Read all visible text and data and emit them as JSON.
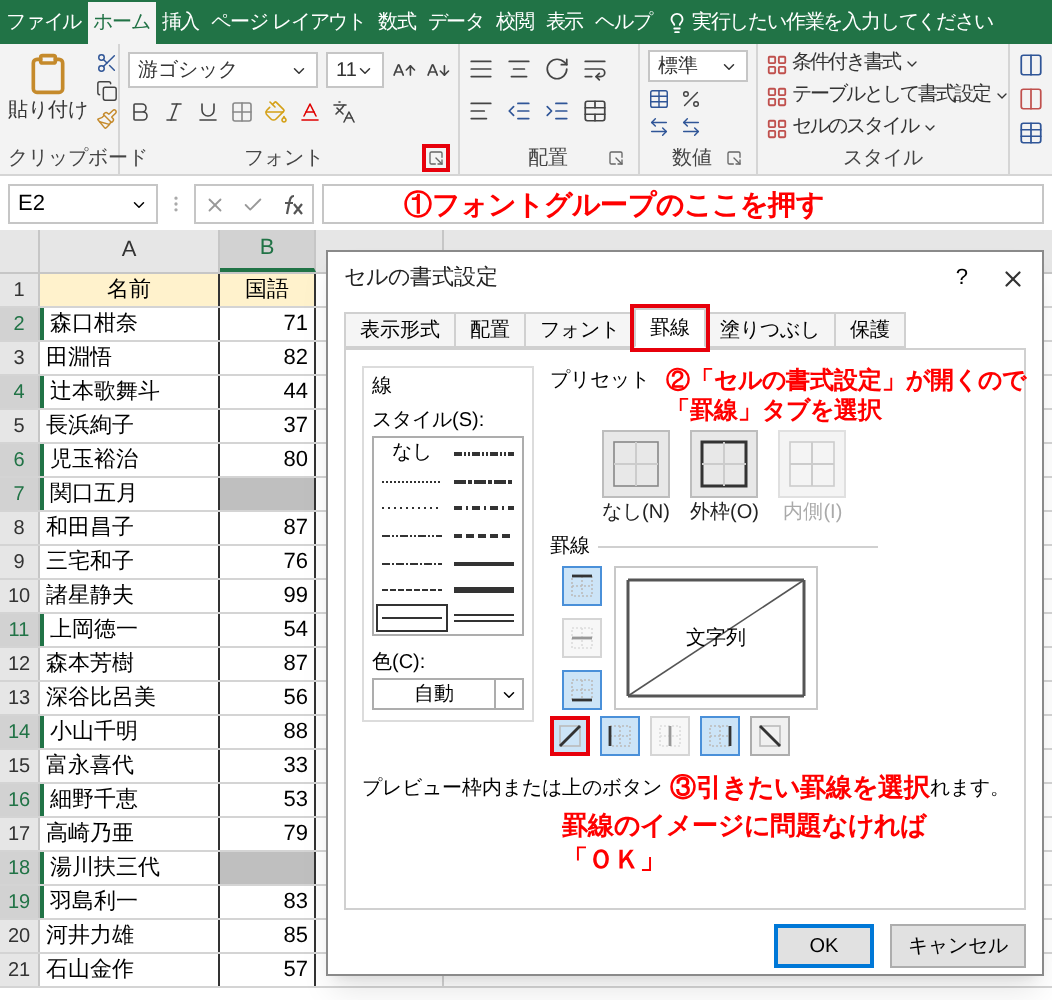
{
  "ribbon_tabs": [
    {
      "label": "ファイル",
      "selected": false
    },
    {
      "label": "ホーム",
      "selected": true
    },
    {
      "label": "挿入",
      "selected": false
    },
    {
      "label": "ページ レイアウト",
      "selected": false
    },
    {
      "label": "数式",
      "selected": false
    },
    {
      "label": "データ",
      "selected": false
    },
    {
      "label": "校閲",
      "selected": false
    },
    {
      "label": "表示",
      "selected": false
    },
    {
      "label": "ヘルプ",
      "selected": false
    }
  ],
  "tell_me": {
    "placeholder": "実行したい作業を入力してください"
  },
  "ribbon": {
    "clipboard": {
      "paste_label": "貼り付け",
      "group_label": "クリップボード"
    },
    "font": {
      "font_name": "游ゴシック",
      "font_size": "11",
      "group_label": "フォント",
      "launcher_highlighted": true
    },
    "alignment": {
      "group_label": "配置"
    },
    "number": {
      "format": "標準",
      "group_label": "数値"
    },
    "styles": {
      "items": [
        "条件付き書式",
        "テーブルとして書式設定",
        "セルのスタイル"
      ],
      "group_label": "スタイル"
    }
  },
  "formula_bar": {
    "name_box": "E2"
  },
  "annotations": {
    "step1": "①フォントグループのここを押す",
    "step2": [
      "②「セルの書式設定」が開くので",
      "「罫線」タブを選択"
    ],
    "step3": [
      "③引きたい罫線を選択",
      "罫線のイメージに問題なければ",
      "「ＯＫ」"
    ]
  },
  "sheet": {
    "columns": [
      {
        "label": "A",
        "selected": false
      },
      {
        "label": "B",
        "selected": true
      }
    ],
    "rows": [
      {
        "number": "1",
        "selected": false,
        "kind": "header",
        "cells": [
          {
            "text": "名前"
          },
          {
            "text": "国語"
          }
        ]
      },
      {
        "number": "2",
        "selected": true,
        "kind": "data",
        "cells": [
          {
            "text": "森口柑奈"
          },
          {
            "text": "71"
          }
        ]
      },
      {
        "number": "3",
        "selected": false,
        "kind": "data",
        "cells": [
          {
            "text": "田淵悟"
          },
          {
            "text": "82"
          }
        ]
      },
      {
        "number": "4",
        "selected": true,
        "kind": "data",
        "cells": [
          {
            "text": "辻本歌舞斗"
          },
          {
            "text": "44"
          }
        ]
      },
      {
        "number": "5",
        "selected": false,
        "kind": "data",
        "cells": [
          {
            "text": "長浜絢子"
          },
          {
            "text": "37"
          }
        ]
      },
      {
        "number": "6",
        "selected": true,
        "kind": "data",
        "cells": [
          {
            "text": "児玉裕治"
          },
          {
            "text": "80"
          }
        ]
      },
      {
        "number": "7",
        "selected": true,
        "kind": "data",
        "cells": [
          {
            "text": "関口五月"
          },
          {
            "shaded": true
          }
        ]
      },
      {
        "number": "8",
        "selected": false,
        "kind": "data",
        "cells": [
          {
            "text": "和田昌子"
          },
          {
            "text": "87"
          }
        ]
      },
      {
        "number": "9",
        "selected": false,
        "kind": "data",
        "cells": [
          {
            "text": "三宅和子"
          },
          {
            "text": "76"
          }
        ]
      },
      {
        "number": "10",
        "selected": false,
        "kind": "data",
        "cells": [
          {
            "text": "諸星静夫"
          },
          {
            "text": "99"
          }
        ]
      },
      {
        "number": "11",
        "selected": true,
        "kind": "data",
        "cells": [
          {
            "text": "上岡徳一"
          },
          {
            "text": "54"
          }
        ]
      },
      {
        "number": "12",
        "selected": false,
        "kind": "data",
        "cells": [
          {
            "text": "森本芳樹"
          },
          {
            "text": "87"
          }
        ]
      },
      {
        "number": "13",
        "selected": false,
        "kind": "data",
        "cells": [
          {
            "text": "深谷比呂美"
          },
          {
            "text": "56"
          }
        ]
      },
      {
        "number": "14",
        "selected": true,
        "kind": "data",
        "cells": [
          {
            "text": "小山千明"
          },
          {
            "text": "88"
          }
        ]
      },
      {
        "number": "15",
        "selected": false,
        "kind": "data",
        "cells": [
          {
            "text": "富永喜代"
          },
          {
            "text": "33"
          }
        ]
      },
      {
        "number": "16",
        "selected": true,
        "kind": "data",
        "cells": [
          {
            "text": "細野千恵"
          },
          {
            "text": "53"
          }
        ]
      },
      {
        "number": "17",
        "selected": false,
        "kind": "data",
        "cells": [
          {
            "text": "高崎乃亜"
          },
          {
            "text": "79"
          }
        ]
      },
      {
        "number": "18",
        "selected": true,
        "kind": "data",
        "cells": [
          {
            "text": "湯川扶三代"
          },
          {
            "shaded": true
          }
        ]
      },
      {
        "number": "19",
        "selected": true,
        "kind": "data",
        "cells": [
          {
            "text": "羽島利一"
          },
          {
            "text": "83"
          }
        ]
      },
      {
        "number": "20",
        "selected": false,
        "kind": "data",
        "cells": [
          {
            "text": "河井力雄"
          },
          {
            "text": "85"
          }
        ]
      },
      {
        "number": "21",
        "selected": false,
        "kind": "data",
        "cells": [
          {
            "text": "石山金作"
          },
          {
            "text": "57"
          }
        ]
      }
    ]
  },
  "dialog": {
    "title": "セルの書式設定",
    "help": "?",
    "tabs": [
      {
        "label": "表示形式",
        "selected": false,
        "highlighted": false
      },
      {
        "label": "配置",
        "selected": false,
        "highlighted": false
      },
      {
        "label": "フォント",
        "selected": false,
        "highlighted": false
      },
      {
        "label": "罫線",
        "selected": true,
        "highlighted": true
      },
      {
        "label": "塗りつぶし",
        "selected": false,
        "highlighted": false
      },
      {
        "label": "保護",
        "selected": false,
        "highlighted": false
      }
    ],
    "line_group": {
      "label": "線",
      "style_label": "スタイル(S):",
      "color_label": "色(C):",
      "color_value": "自動",
      "styles": [
        {
          "kind": "none",
          "label": "なし",
          "selected": false
        },
        {
          "kind": "hair",
          "selected": false
        },
        {
          "kind": "dotted",
          "selected": false
        },
        {
          "kind": "dash-dot-dot",
          "selected": false
        },
        {
          "kind": "dash-dot",
          "selected": false
        },
        {
          "kind": "dashed",
          "selected": false
        },
        {
          "kind": "thin",
          "selected": true
        },
        {
          "kind": "medium-dash-dot-dot",
          "selected": false
        },
        {
          "kind": "slant-dash-dot",
          "selected": false
        },
        {
          "kind": "medium-dash-dot",
          "selected": false
        },
        {
          "kind": "medium-dashed",
          "selected": false
        },
        {
          "kind": "medium",
          "selected": false
        },
        {
          "kind": "thick",
          "selected": false
        },
        {
          "kind": "double",
          "selected": false
        }
      ]
    },
    "presets": {
      "label": "プリセット",
      "items": [
        {
          "kind": "none",
          "label": "なし(N)",
          "disabled": false
        },
        {
          "kind": "outline",
          "label": "外枠(O)",
          "disabled": false
        },
        {
          "kind": "inside",
          "label": "内側(I)",
          "disabled": true
        }
      ]
    },
    "borders": {
      "label": "罫線",
      "preview_text": "文字列",
      "buttons": [
        {
          "kind": "top",
          "pressed": true,
          "disabled": false,
          "highlighted": false
        },
        {
          "kind": "middle",
          "pressed": false,
          "disabled": true,
          "highlighted": false
        },
        {
          "kind": "bottom",
          "pressed": true,
          "disabled": false,
          "highlighted": false
        },
        {
          "kind": "diagonal-up",
          "pressed": true,
          "disabled": false,
          "highlighted": true
        },
        {
          "kind": "left",
          "pressed": true,
          "disabled": false,
          "highlighted": false
        },
        {
          "kind": "center",
          "pressed": false,
          "disabled": true,
          "highlighted": false
        },
        {
          "kind": "right",
          "pressed": true,
          "disabled": false,
          "highlighted": false
        },
        {
          "kind": "diagonal-down",
          "pressed": false,
          "disabled": false,
          "highlighted": false
        }
      ]
    },
    "help_text_parts": [
      "プレビュー枠内または上のボタン",
      "れます。"
    ],
    "buttons": [
      {
        "label": "OK",
        "default": true
      },
      {
        "label": "キャンセル",
        "default": false
      }
    ]
  }
}
